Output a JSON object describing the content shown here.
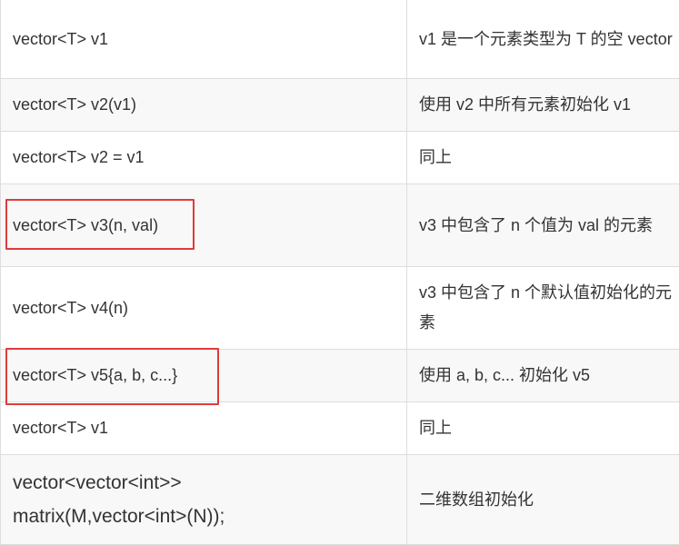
{
  "rows": [
    {
      "code": "vector<T> v1",
      "desc": "v1 是一个元素类型为 T 的空 vector"
    },
    {
      "code": "vector<T> v2(v1)",
      "desc": "使用 v2 中所有元素初始化 v1"
    },
    {
      "code": "vector<T> v2 = v1",
      "desc": "同上"
    },
    {
      "code": "vector<T> v3(n, val)",
      "desc": "v3 中包含了 n 个值为 val 的元素"
    },
    {
      "code": "vector<T> v4(n)",
      "desc": "v3 中包含了 n 个默认值初始化的元素"
    },
    {
      "code": "vector<T> v5{a, b, c...}",
      "desc": "使用 a, b, c... 初始化 v5"
    },
    {
      "code": "vector<T> v1",
      "desc": "同上"
    },
    {
      "code": "vector<vector<int>> matrix(M,vector<int>(N));",
      "desc": "二维数组初始化"
    }
  ],
  "highlight_color": "#e03a3a"
}
